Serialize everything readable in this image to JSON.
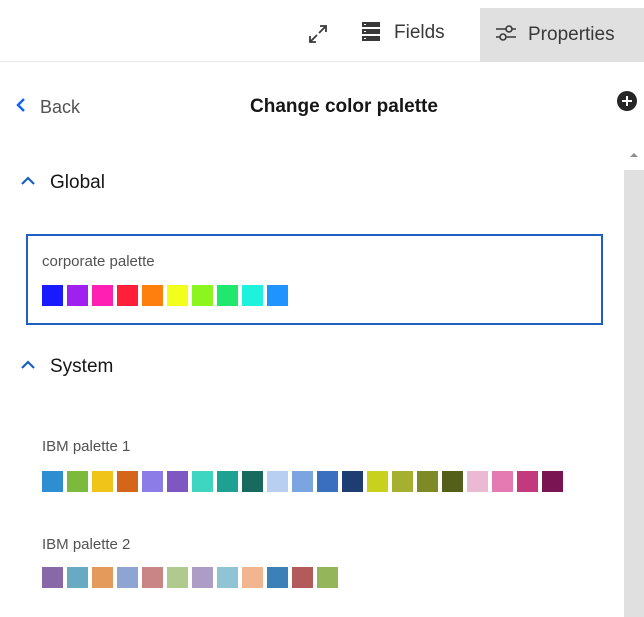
{
  "toolbar": {
    "expand_icon": "expand-icon",
    "fields_label": "Fields",
    "fields_icon": "fields-icon",
    "properties_label": "Properties",
    "properties_icon": "sliders-icon"
  },
  "header": {
    "back_label": "Back",
    "title": "Change color palette",
    "add_icon": "add-icon"
  },
  "sections": {
    "global": {
      "label": "Global",
      "palettes": [
        {
          "name": "corporate palette",
          "selected": true,
          "colors": [
            "#1a1aff",
            "#a020f0",
            "#ff1fb3",
            "#ff1f3a",
            "#ff7f0e",
            "#f2ff1a",
            "#8cf51f",
            "#1fe86c",
            "#1ff2dc",
            "#1f94ff"
          ]
        }
      ]
    },
    "system": {
      "label": "System",
      "palettes": [
        {
          "name": "IBM palette 1",
          "selected": false,
          "colors": [
            "#2d8fd2",
            "#7cba3d",
            "#f0c419",
            "#d3661b",
            "#8b7ce8",
            "#7e57c2",
            "#3ed6c1",
            "#1ea193",
            "#18695e",
            "#b9cff2",
            "#7aa5e0",
            "#3a6fc0",
            "#1e3d73",
            "#c8d21e",
            "#a6b030",
            "#7d8a26",
            "#545f1a",
            "#ebbad2",
            "#e57ab2",
            "#c2397d",
            "#7a1452"
          ]
        },
        {
          "name": "IBM palette 2",
          "selected": false,
          "colors": [
            "#8868a6",
            "#68aac1",
            "#e39a5b",
            "#8ea4d2",
            "#c98585",
            "#b0c98c",
            "#ad9cc6",
            "#90c3d4",
            "#f1b58f",
            "#3c80b8",
            "#b35a5a",
            "#94b55a"
          ]
        }
      ]
    }
  }
}
